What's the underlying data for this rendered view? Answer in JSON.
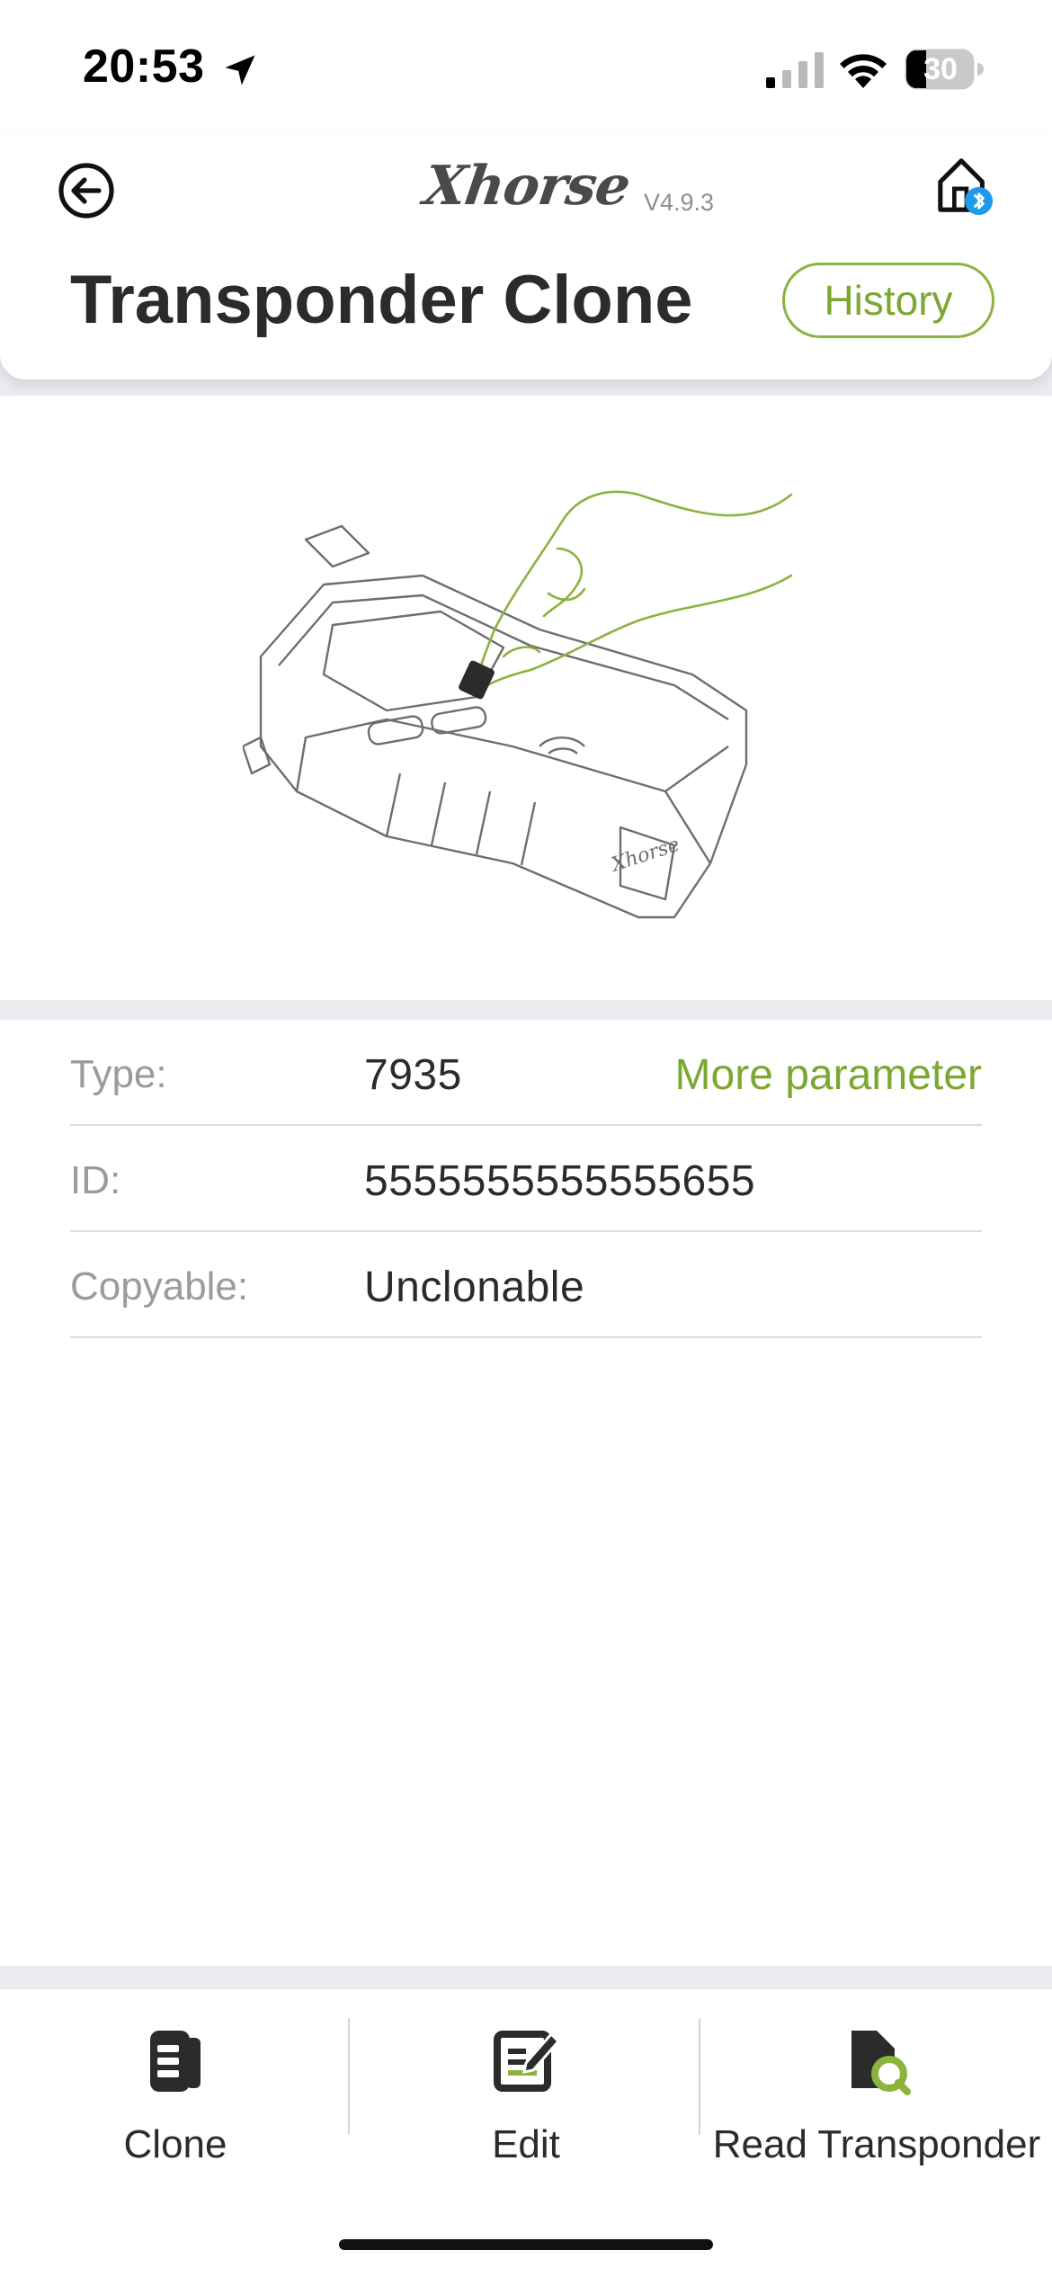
{
  "status_bar": {
    "time": "20:53",
    "battery": "30",
    "icons": [
      "location-arrow-icon",
      "signal-icon",
      "wifi-icon",
      "battery-icon"
    ]
  },
  "header": {
    "brand": "Xhorse",
    "version": "V4.9.3",
    "title": "Transponder Clone",
    "history_label": "History",
    "accent_color": "#7aa830"
  },
  "info": {
    "rows": [
      {
        "label": "Type:",
        "value": "7935",
        "action": "More parameter"
      },
      {
        "label": "ID:",
        "value": "5555555555555655"
      },
      {
        "label": "Copyable:",
        "value": "Unclonable"
      }
    ]
  },
  "tabbar": {
    "tabs": [
      {
        "label": "Clone",
        "icon": "car-key-icon"
      },
      {
        "label": "Edit",
        "icon": "edit-icon"
      },
      {
        "label": "Read Transponder",
        "icon": "read-transponder-icon"
      }
    ]
  }
}
